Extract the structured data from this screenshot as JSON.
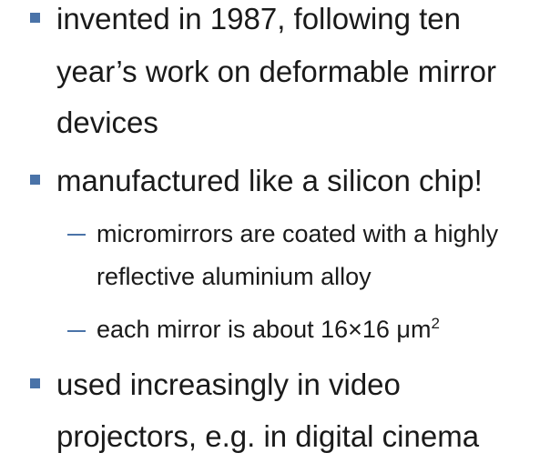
{
  "items": [
    {
      "lines": [
        "invented in 1987, following ten",
        "year’s work on deformable mirror",
        "devices"
      ]
    },
    {
      "lines": [
        "manufactured like a silicon chip!"
      ],
      "subitems": [
        {
          "lines": [
            "micromirrors are coated with a highly",
            "reflective aluminium alloy"
          ]
        },
        {
          "text": "each mirror is about 16×16 μm",
          "sup": "2"
        }
      ]
    },
    {
      "lines": [
        "used increasingly in video",
        "projectors, e.g. in digital cinema"
      ]
    }
  ],
  "colors": {
    "bullet": "#4a73a8",
    "text": "#1a1a1a",
    "background": "#ffffff"
  },
  "icons": {
    "bullet": "square-bullet-icon",
    "sub_bullet": "dash-bullet-icon"
  }
}
